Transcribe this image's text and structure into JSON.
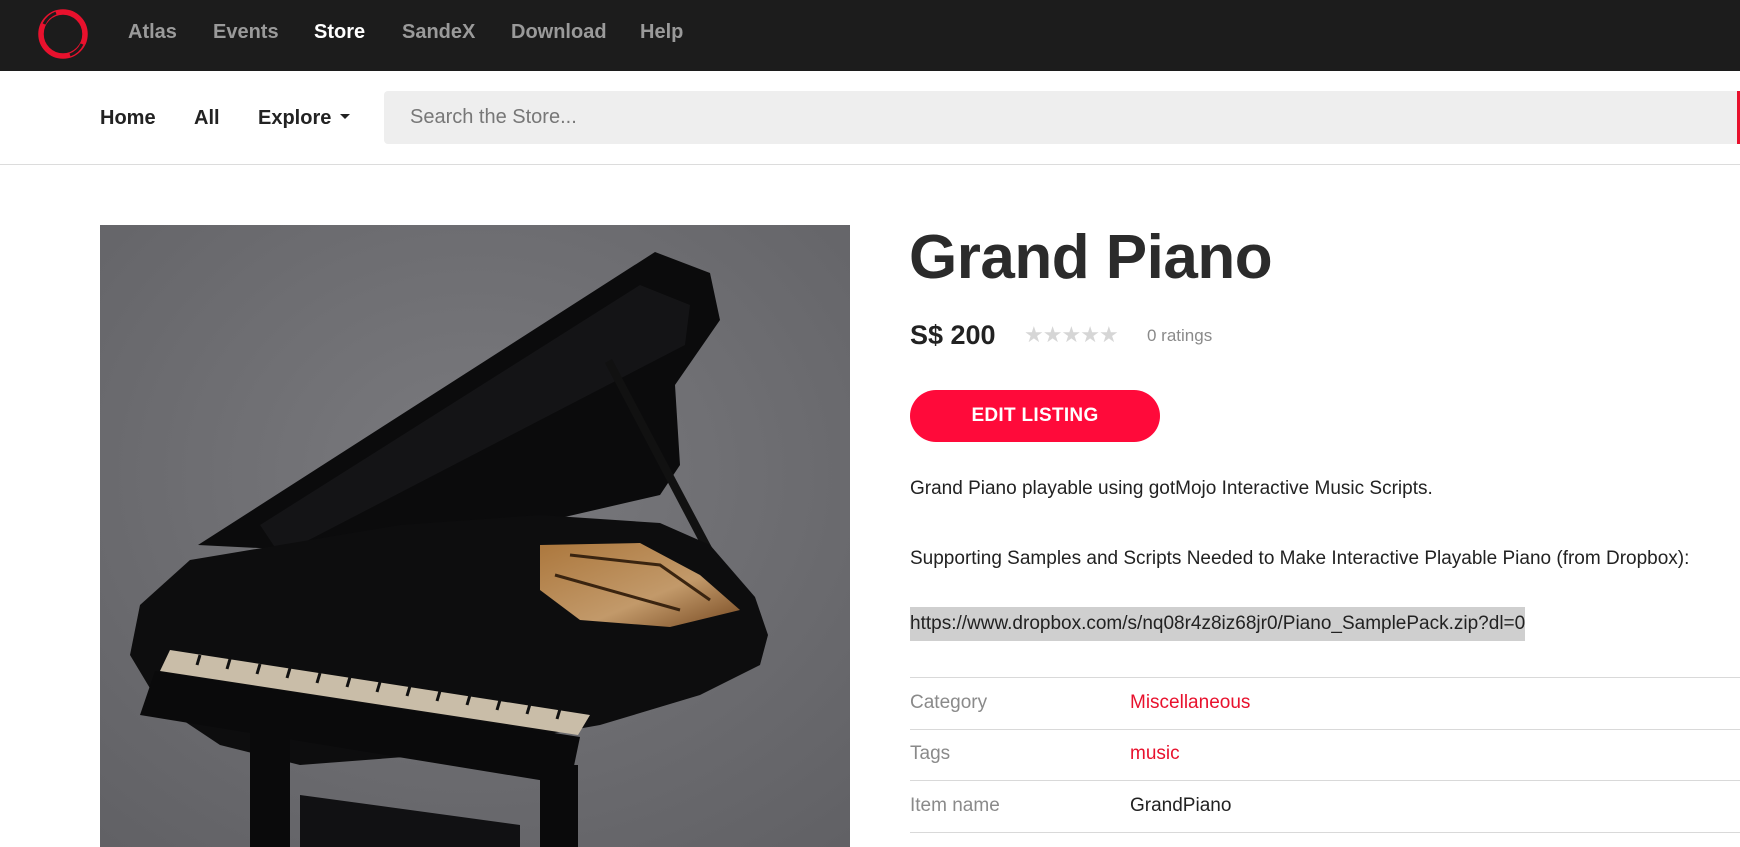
{
  "colors": {
    "accent": "#ff0a3a",
    "nav_bg": "#1c1c1c",
    "link": "#e8112d"
  },
  "topnav": {
    "logo_icon": "ring-logo-icon",
    "items": [
      {
        "label": "Atlas",
        "active": false
      },
      {
        "label": "Events",
        "active": false
      },
      {
        "label": "Store",
        "active": true
      },
      {
        "label": "SandeX",
        "active": false
      },
      {
        "label": "Download",
        "active": false
      },
      {
        "label": "Help",
        "active": false
      }
    ]
  },
  "subnav": {
    "home": "Home",
    "all": "All",
    "explore": "Explore",
    "explore_icon": "caret-down-icon",
    "search_placeholder": "Search the Store..."
  },
  "product": {
    "title": "Grand Piano",
    "price": "S$ 200",
    "rating_stars": 0,
    "ratings_text": "0 ratings",
    "edit_label": "EDIT LISTING",
    "description_1": "Grand Piano playable using gotMojo Interactive Music Scripts.",
    "description_2": "Supporting Samples and Scripts Needed to Make Interactive Playable Piano (from Dropbox):",
    "link": "https://www.dropbox.com/s/nq08r4z8iz68jr0/Piano_SamplePack.zip?dl=0",
    "image_icon": "grand-piano-image"
  },
  "details": {
    "category": {
      "label": "Category",
      "value": "Miscellaneous"
    },
    "tags": {
      "label": "Tags",
      "value": "music"
    },
    "item_name": {
      "label": "Item name",
      "value": "GrandPiano"
    }
  }
}
